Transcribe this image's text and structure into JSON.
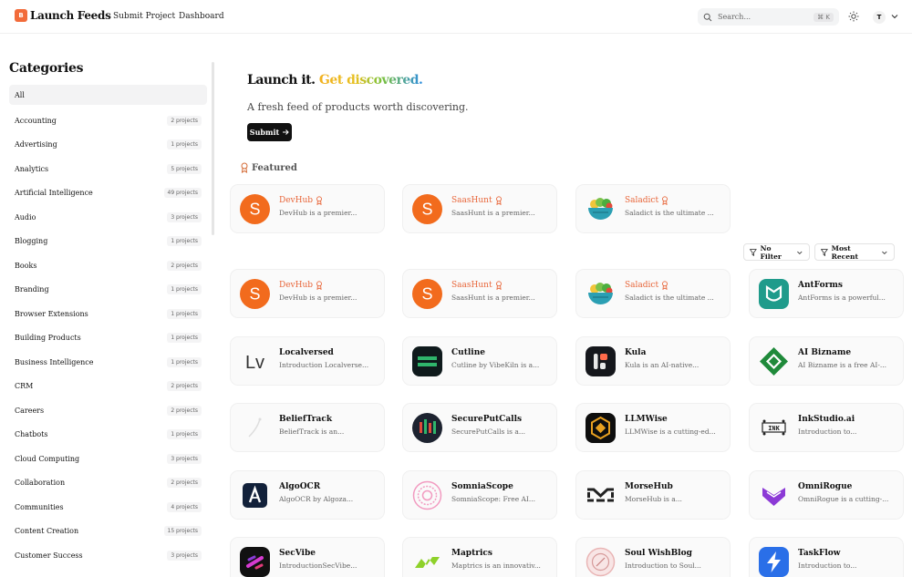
{
  "header": {
    "logo_badge": "B",
    "logo_text": "Launch Feeds",
    "nav": [
      "Submit Project",
      "Dashboard"
    ],
    "search_placeholder": "Search...",
    "search_shortcut": "⌘ K",
    "avatar_initial": "T"
  },
  "sidebar": {
    "title": "Categories",
    "items": [
      {
        "name": "All",
        "count": ""
      },
      {
        "name": "Accounting",
        "count": "2 projects"
      },
      {
        "name": "Advertising",
        "count": "1 projects"
      },
      {
        "name": "Analytics",
        "count": "5 projects"
      },
      {
        "name": "Artificial Intelligence",
        "count": "49 projects"
      },
      {
        "name": "Audio",
        "count": "3 projects"
      },
      {
        "name": "Blogging",
        "count": "1 projects"
      },
      {
        "name": "Books",
        "count": "2 projects"
      },
      {
        "name": "Branding",
        "count": "1 projects"
      },
      {
        "name": "Browser Extensions",
        "count": "1 projects"
      },
      {
        "name": "Building Products",
        "count": "1 projects"
      },
      {
        "name": "Business Intelligence",
        "count": "1 projects"
      },
      {
        "name": "CRM",
        "count": "2 projects"
      },
      {
        "name": "Careers",
        "count": "2 projects"
      },
      {
        "name": "Chatbots",
        "count": "1 projects"
      },
      {
        "name": "Cloud Computing",
        "count": "3 projects"
      },
      {
        "name": "Collaboration",
        "count": "2 projects"
      },
      {
        "name": "Communities",
        "count": "4 projects"
      },
      {
        "name": "Content Creation",
        "count": "15 projects"
      },
      {
        "name": "Customer Success",
        "count": "3 projects"
      }
    ]
  },
  "hero": {
    "title_plain": "Launch it.",
    "title_accent": "Get discovered.",
    "subtitle": "A fresh feed of products worth discovering.",
    "button": "Submit"
  },
  "featured": {
    "label": "Featured",
    "cards": [
      {
        "name": "DevHub",
        "desc": "DevHub is a premier...",
        "icon": "devhub-s-icon"
      },
      {
        "name": "SaasHunt",
        "desc": "SaasHunt is a premier...",
        "icon": "saashunt-s-icon"
      },
      {
        "name": "Saladict",
        "desc": "Saladict is the ultimate ...",
        "icon": "saladict-bowl-icon"
      }
    ]
  },
  "filters": {
    "filter": "No Filter",
    "sort": "Most Recent"
  },
  "projects": [
    {
      "name": "DevHub",
      "desc": "DevHub is a premier...",
      "featured": true,
      "icon": "devhub-s-icon"
    },
    {
      "name": "SaasHunt",
      "desc": "SaasHunt is a premier...",
      "featured": true,
      "icon": "saashunt-s-icon"
    },
    {
      "name": "Saladict",
      "desc": "Saladict is the ultimate ...",
      "featured": true,
      "icon": "saladict-bowl-icon"
    },
    {
      "name": "AntForms",
      "desc": "AntForms is a powerful...",
      "featured": false,
      "icon": "antforms-icon"
    },
    {
      "name": "Localversed",
      "desc": "Introduction Localverse...",
      "featured": false,
      "icon": "localversed-lv-icon"
    },
    {
      "name": "Cutline",
      "desc": "Cutline by VibeKiln is a...",
      "featured": false,
      "icon": "cutline-icon"
    },
    {
      "name": "Kula",
      "desc": "Kula is an AI-native...",
      "featured": false,
      "icon": "kula-icon"
    },
    {
      "name": "AI Bizname",
      "desc": "AI Bizname is a free AI-...",
      "featured": false,
      "icon": "ai-bizname-icon"
    },
    {
      "name": "BeliefTrack",
      "desc": "BeliefTrack is an...",
      "featured": false,
      "icon": "belieftrack-icon"
    },
    {
      "name": "SecurePutCalls",
      "desc": "SecurePutCalls is a...",
      "featured": false,
      "icon": "secureputcalls-icon"
    },
    {
      "name": "LLMWise",
      "desc": "LLMWise is a cutting-ed...",
      "featured": false,
      "icon": "llmwise-icon"
    },
    {
      "name": "InkStudio.ai",
      "desc": "Introduction to...",
      "featured": false,
      "icon": "inkstudio-icon"
    },
    {
      "name": "AlgoOCR",
      "desc": "AlgoOCR by Algoza...",
      "featured": false,
      "icon": "algoocr-icon"
    },
    {
      "name": "SomniaScope",
      "desc": "SomniaScope: Free AI...",
      "featured": false,
      "icon": "somniascope-icon"
    },
    {
      "name": "MorseHub",
      "desc": "MorseHub is a...",
      "featured": false,
      "icon": "morsehub-icon"
    },
    {
      "name": "OmniRogue",
      "desc": "OmniRogue is a cutting-...",
      "featured": false,
      "icon": "omnirogue-icon"
    },
    {
      "name": "SecVibe",
      "desc": "IntroductionSecVibe...",
      "featured": false,
      "icon": "secvibe-icon"
    },
    {
      "name": "Maptrics",
      "desc": "Maptrics is an innovativ...",
      "featured": false,
      "icon": "maptrics-icon"
    },
    {
      "name": "Soul WishBlog",
      "desc": "Introduction to Soul...",
      "featured": false,
      "icon": "soul-wishblog-icon"
    },
    {
      "name": "TaskFlow",
      "desc": "Introduction to...",
      "featured": false,
      "icon": "taskflow-icon"
    }
  ],
  "colors": {
    "accent": "#f26b3a",
    "featured_name": "#e8663a",
    "card_bg": "#fafafa"
  }
}
